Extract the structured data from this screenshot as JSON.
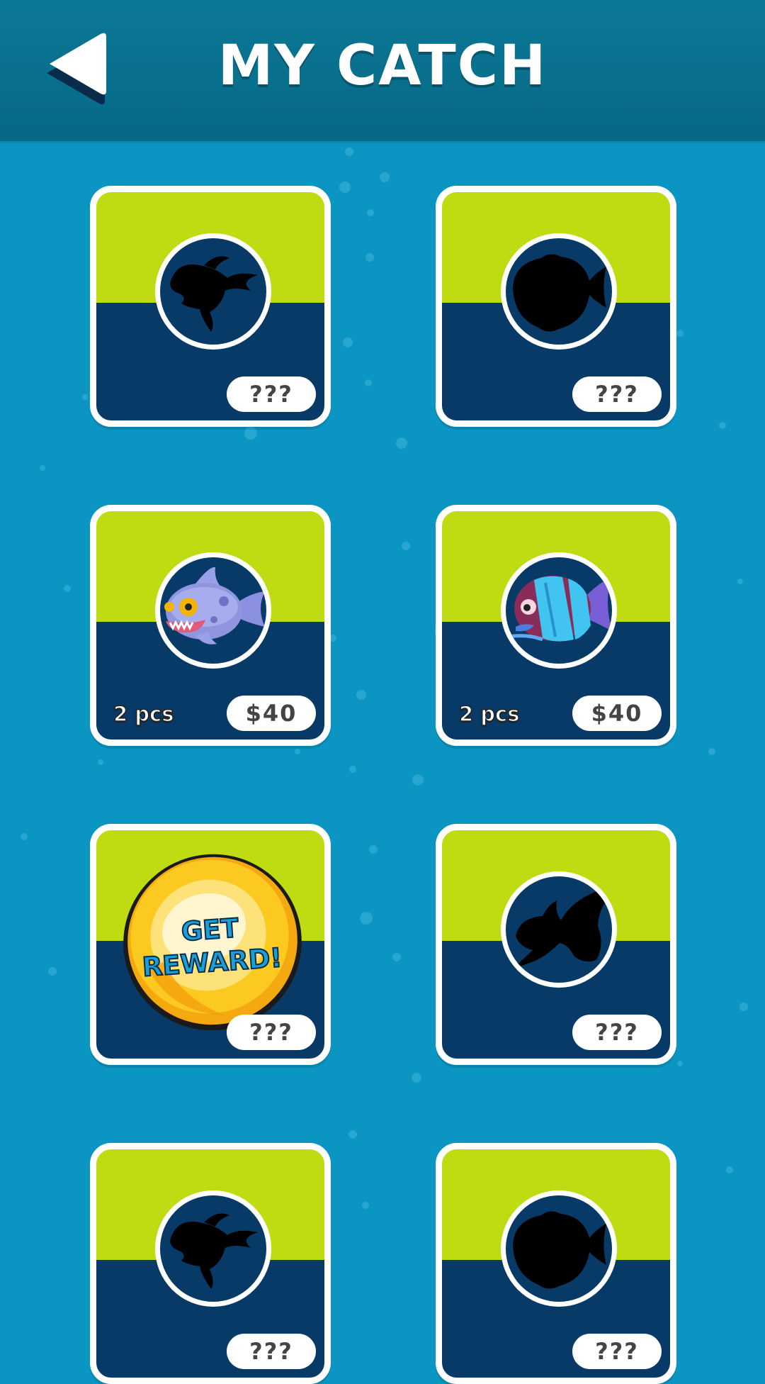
{
  "header": {
    "title": "MY CATCH",
    "back_icon": "back-arrow-icon"
  },
  "colors": {
    "background": "#0b95c2",
    "header": "#066985",
    "card_top": "#bfdc12",
    "card_bottom": "#073a66",
    "card_border": "#ffffff"
  },
  "cards": [
    {
      "status": "locked",
      "icon": "goldfish-silhouette-icon",
      "price": "???"
    },
    {
      "status": "locked",
      "icon": "discus-fish-silhouette-icon",
      "price": "???"
    },
    {
      "status": "caught",
      "icon": "piranha-fish-icon",
      "count": "2 pcs",
      "price": "$40"
    },
    {
      "status": "caught",
      "icon": "angelfish-icon",
      "count": "2 pcs",
      "price": "$40"
    },
    {
      "status": "reward",
      "icon": "gold-coin-icon",
      "reward_label": "GET REWARD!",
      "price": "???"
    },
    {
      "status": "locked",
      "icon": "betta-fish-silhouette-icon",
      "price": "???"
    },
    {
      "status": "locked",
      "icon": "goldfish-silhouette-icon",
      "price": "???"
    },
    {
      "status": "locked",
      "icon": "discus-fish-silhouette-icon",
      "price": "???"
    }
  ]
}
